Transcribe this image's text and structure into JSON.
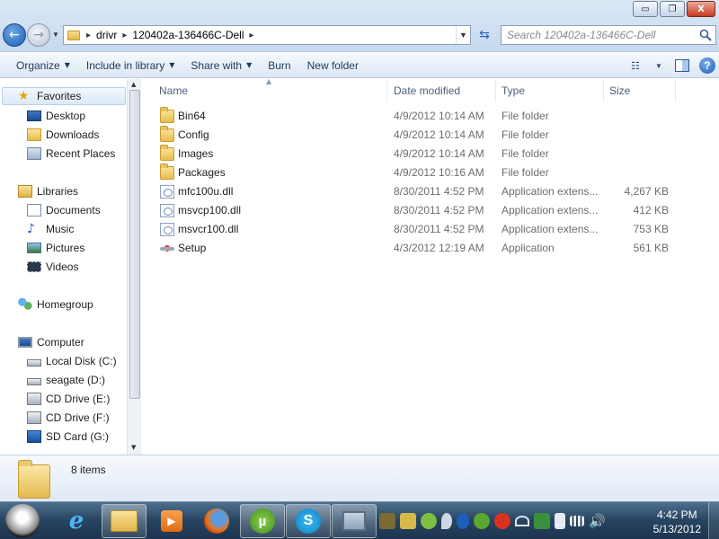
{
  "window": {
    "minimize_label": "▭",
    "maximize_label": "❐",
    "close_label": "X"
  },
  "address": {
    "breadcrumbs": [
      "drivr",
      "120402a-136466C-Dell"
    ]
  },
  "search": {
    "placeholder": "Search 120402a-136466C-Dell"
  },
  "toolbar": {
    "organize": "Organize",
    "include_in_library": "Include in library",
    "share_with": "Share with",
    "burn": "Burn",
    "new_folder": "New folder"
  },
  "nav": {
    "favorites": "Favorites",
    "desktop": "Desktop",
    "downloads": "Downloads",
    "recent_places": "Recent Places",
    "libraries": "Libraries",
    "documents": "Documents",
    "music": "Music",
    "pictures": "Pictures",
    "videos": "Videos",
    "homegroup": "Homegroup",
    "computer": "Computer",
    "drives": [
      "Local Disk (C:)",
      "seagate (D:)",
      "CD Drive (E:)",
      "CD Drive (F:)",
      "SD Card (G:)"
    ]
  },
  "columns": {
    "name": "Name",
    "date_modified": "Date modified",
    "type": "Type",
    "size": "Size"
  },
  "files": [
    {
      "name": "Bin64",
      "date": "4/9/2012 10:14 AM",
      "type": "File folder",
      "size": "",
      "icon": "folder-icon"
    },
    {
      "name": "Config",
      "date": "4/9/2012 10:14 AM",
      "type": "File folder",
      "size": "",
      "icon": "folder-icon"
    },
    {
      "name": "Images",
      "date": "4/9/2012 10:14 AM",
      "type": "File folder",
      "size": "",
      "icon": "folder-icon"
    },
    {
      "name": "Packages",
      "date": "4/9/2012 10:16 AM",
      "type": "File folder",
      "size": "",
      "icon": "folder-icon"
    },
    {
      "name": "mfc100u.dll",
      "date": "8/30/2011 4:52 PM",
      "type": "Application extens...",
      "size": "4,267 KB",
      "icon": "dll-icon"
    },
    {
      "name": "msvcp100.dll",
      "date": "8/30/2011 4:52 PM",
      "type": "Application extens...",
      "size": "412 KB",
      "icon": "dll-icon"
    },
    {
      "name": "msvcr100.dll",
      "date": "8/30/2011 4:52 PM",
      "type": "Application extens...",
      "size": "753 KB",
      "icon": "dll-icon"
    },
    {
      "name": "Setup",
      "date": "4/3/2012 12:19 AM",
      "type": "Application",
      "size": "561 KB",
      "icon": "setup-icon"
    }
  ],
  "details": {
    "item_count": "8 items"
  },
  "taskbar": {
    "time": "4:42 PM",
    "date": "5/13/2012"
  },
  "colors": {
    "accent": "#1e395b",
    "taskbar": "#274460"
  }
}
